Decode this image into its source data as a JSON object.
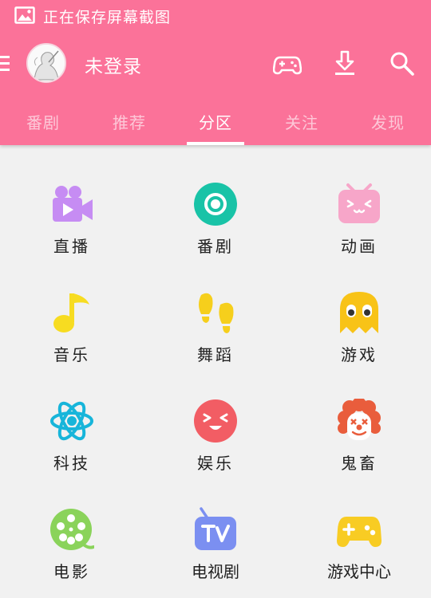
{
  "status_bar": {
    "text": "正在保存屏幕截图"
  },
  "toolbar": {
    "username": "未登录"
  },
  "tabs": [
    {
      "label": "番剧"
    },
    {
      "label": "推荐"
    },
    {
      "label": "分区",
      "active": true
    },
    {
      "label": "关注"
    },
    {
      "label": "发现"
    }
  ],
  "categories": [
    {
      "label": "直播",
      "icon": "live-camera-icon",
      "color": "#c68cf3"
    },
    {
      "label": "番剧",
      "icon": "bangumi-icon",
      "color": "#19c3a7"
    },
    {
      "label": "动画",
      "icon": "tv-face-icon",
      "color": "#f7a6c9"
    },
    {
      "label": "音乐",
      "icon": "music-note-icon",
      "color": "#f7dc21"
    },
    {
      "label": "舞蹈",
      "icon": "footprints-icon",
      "color": "#f6cf1c"
    },
    {
      "label": "游戏",
      "icon": "ghost-icon",
      "color": "#f8c317"
    },
    {
      "label": "科技",
      "icon": "atom-icon",
      "color": "#17b5da"
    },
    {
      "label": "娱乐",
      "icon": "smile-icon",
      "color": "#f25d64"
    },
    {
      "label": "鬼畜",
      "icon": "clown-icon",
      "color": "#e95d3c"
    },
    {
      "label": "电影",
      "icon": "film-reel-icon",
      "color": "#8ad35a"
    },
    {
      "label": "电视剧",
      "icon": "tv-icon",
      "color": "#7b8ff1"
    },
    {
      "label": "游戏中心",
      "icon": "gamepad-icon",
      "color": "#f8cc23"
    }
  ]
}
